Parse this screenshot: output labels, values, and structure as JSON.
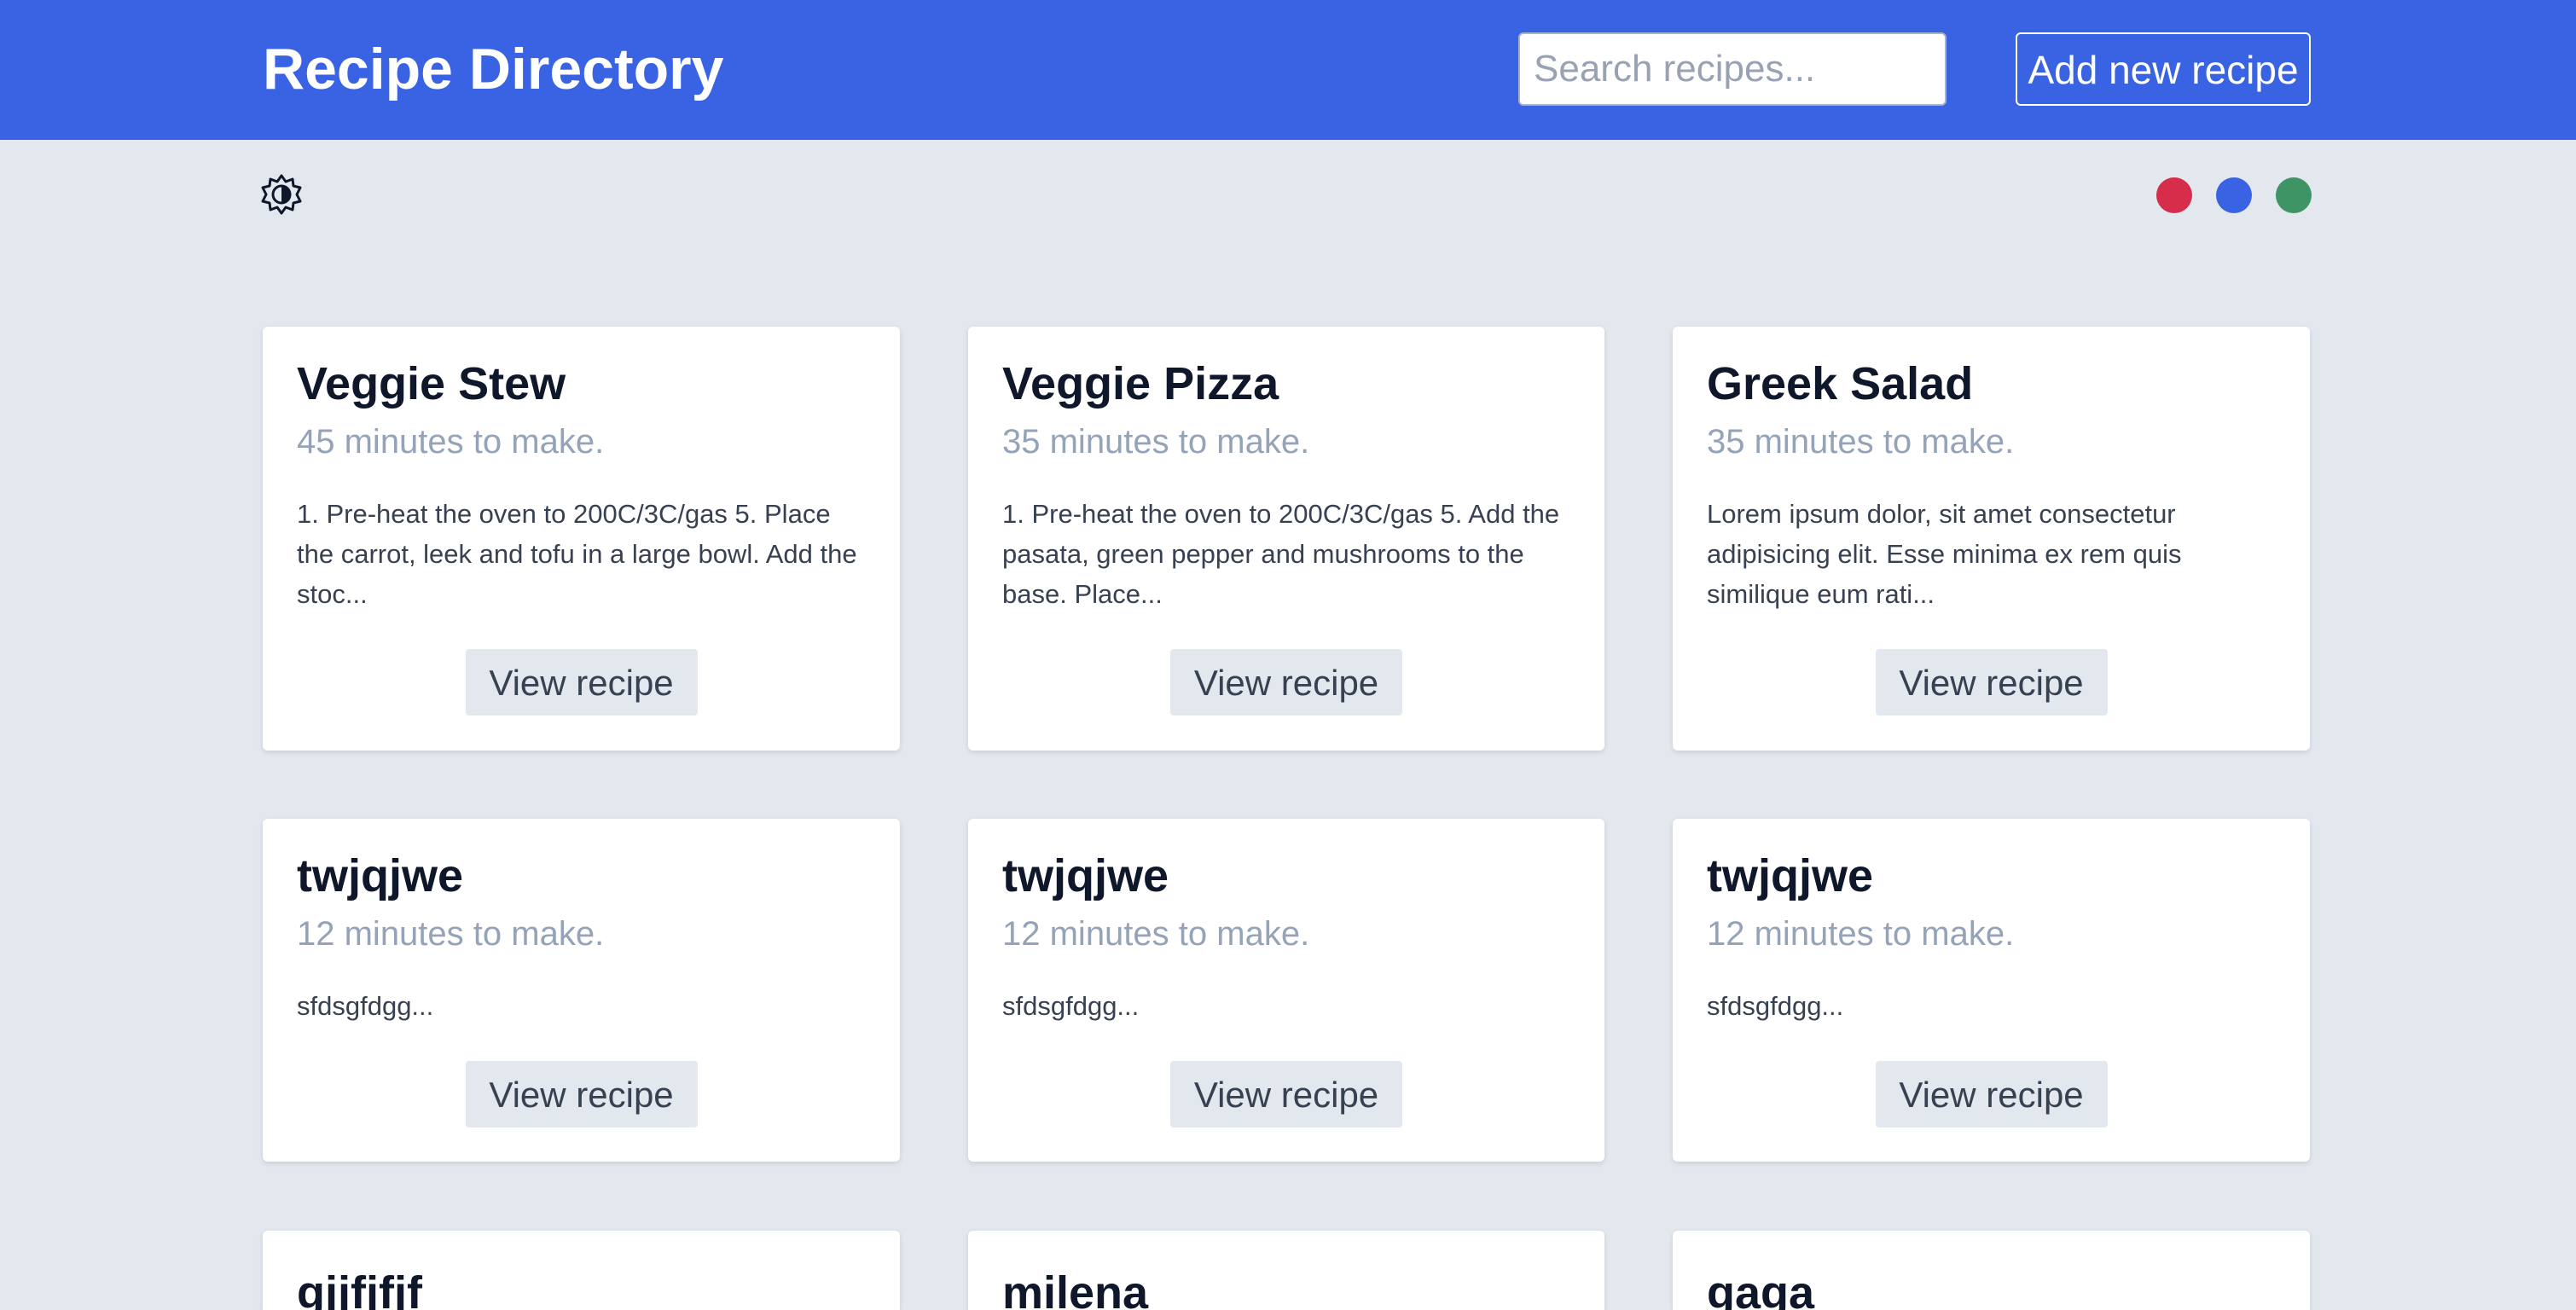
{
  "header": {
    "title": "Recipe Directory",
    "search_placeholder": "Search recipes...",
    "search_value": "",
    "add_label": "Add new recipe"
  },
  "toolbar": {
    "theme_icon": "brightness-icon",
    "swatches": [
      {
        "name": "red",
        "color": "#d62d4a"
      },
      {
        "name": "blue",
        "color": "#3a63e3"
      },
      {
        "name": "green",
        "color": "#3f9465"
      }
    ]
  },
  "recipes": [
    {
      "title": "Veggie Stew",
      "time": "45 minutes to make.",
      "description": "1. Pre-heat the oven to 200C/3C/gas 5. Place the carrot, leek and tofu in a large bowl. Add the stoc...",
      "button": "View recipe"
    },
    {
      "title": "Veggie Pizza",
      "time": "35 minutes to make.",
      "description": "1. Pre-heat the oven to 200C/3C/gas 5. Add the pasata, green pepper and mushrooms to the base. Place...",
      "button": "View recipe"
    },
    {
      "title": "Greek Salad",
      "time": "35 minutes to make.",
      "description": "Lorem ipsum dolor, sit amet consectetur adipisicing elit. Esse minima ex rem quis similique eum rati...",
      "button": "View recipe"
    },
    {
      "title": "twjqjwe",
      "time": "12 minutes to make.",
      "description": "sfdsgfdgg...",
      "button": "View recipe"
    },
    {
      "title": "twjqjwe",
      "time": "12 minutes to make.",
      "description": "sfdsgfdgg...",
      "button": "View recipe"
    },
    {
      "title": "twjqjwe",
      "time": "12 minutes to make.",
      "description": "sfdsgfdgg...",
      "button": "View recipe"
    },
    {
      "title": "gjjfjfjf"
    },
    {
      "title": "milena"
    },
    {
      "title": "gaga"
    }
  ]
}
